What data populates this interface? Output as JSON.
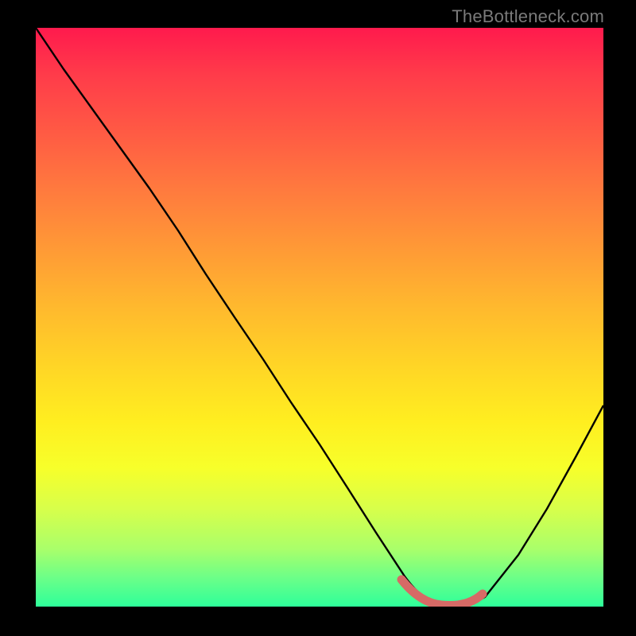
{
  "watermark": "TheBottleneck.com",
  "chart_data": {
    "type": "line",
    "title": "",
    "xlabel": "",
    "ylabel": "",
    "xlim": [
      0,
      100
    ],
    "ylim": [
      0,
      100
    ],
    "series": [
      {
        "name": "bottleneck-curve",
        "x": [
          0,
          5,
          10,
          15,
          20,
          25,
          30,
          35,
          40,
          45,
          50,
          55,
          60,
          65,
          70,
          72,
          75,
          80,
          85,
          90,
          95,
          100
        ],
        "values": [
          100,
          93,
          86,
          79,
          72,
          65,
          57,
          50,
          43,
          35,
          28,
          20,
          13,
          5,
          1,
          0,
          0,
          2,
          9,
          17,
          26,
          35
        ]
      },
      {
        "name": "highlight-segment",
        "x": [
          64,
          66,
          68,
          70,
          72,
          74,
          76,
          78
        ],
        "values": [
          4.5,
          2.5,
          1,
          0.5,
          0.5,
          0.5,
          1,
          2.5
        ]
      }
    ],
    "colors": {
      "curve": "#000000",
      "highlight": "#d66a66",
      "gradient_top": "#ff1a4d",
      "gradient_bottom": "#2eff9a"
    }
  }
}
